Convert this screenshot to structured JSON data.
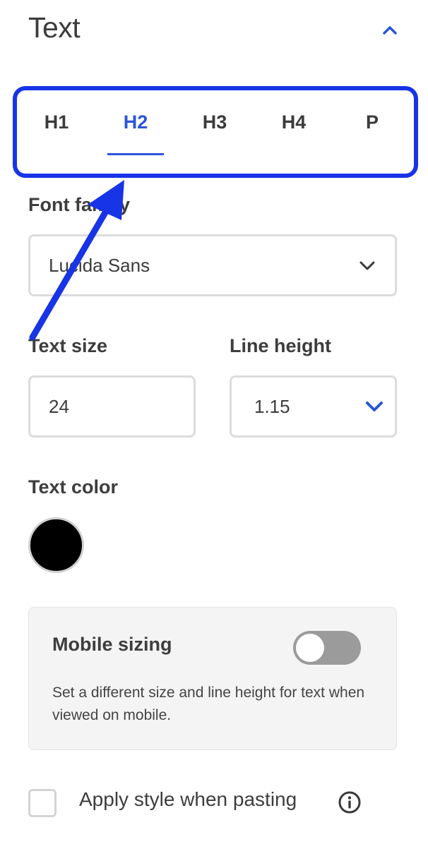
{
  "section": {
    "title": "Text",
    "collapse_icon": "chevron-up-icon"
  },
  "tabs": [
    {
      "label": "H1",
      "active": false
    },
    {
      "label": "H2",
      "active": true
    },
    {
      "label": "H3",
      "active": false
    },
    {
      "label": "H4",
      "active": false
    },
    {
      "label": "P",
      "active": false
    }
  ],
  "font_family": {
    "label": "Font family",
    "value": "Lucida Sans",
    "icon": "chevron-down-icon"
  },
  "text_size": {
    "label": "Text size",
    "value": "24"
  },
  "line_height": {
    "label": "Line height",
    "value": "1.15",
    "icon": "chevron-down-icon"
  },
  "text_color": {
    "label": "Text color",
    "value": "#000000"
  },
  "mobile_sizing": {
    "title": "Mobile sizing",
    "description": "Set a different size and line height for text when viewed on mobile.",
    "enabled": false
  },
  "apply_style": {
    "label": "Apply style when pasting",
    "checked": false,
    "info_icon": "info-icon"
  },
  "annotation": {
    "highlight_color": "#1734e6",
    "arrow_icon": "annotation-arrow"
  },
  "colors": {
    "accent": "#2b55d9",
    "toggle_off": "#9b9b9b"
  }
}
